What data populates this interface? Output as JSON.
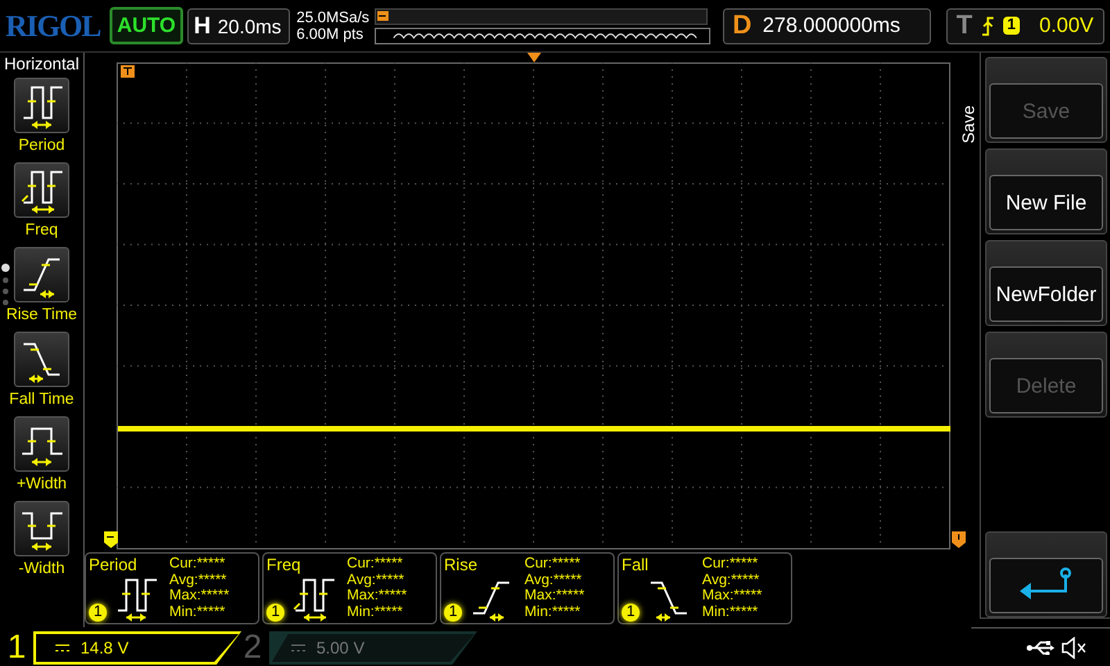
{
  "brand": "RIGOL",
  "run_state": "AUTO",
  "timebase": {
    "label": "H",
    "value": "20.0ms"
  },
  "sample_rate": "25.0MSa/s",
  "memory_depth": "6.00M pts",
  "delay": {
    "label": "D",
    "value": "278.000000ms"
  },
  "trigger": {
    "label": "T",
    "source": "1",
    "level": "0.00V"
  },
  "sidebar": {
    "title": "Horizontal",
    "page_dots": [
      {
        "selected": true
      },
      {
        "selected": false
      },
      {
        "selected": false
      },
      {
        "selected": false
      }
    ],
    "items": [
      {
        "label": "Period",
        "kind": "period"
      },
      {
        "label": "Freq",
        "kind": "freq"
      },
      {
        "label": "Rise Time",
        "kind": "rise"
      },
      {
        "label": "Fall Time",
        "kind": "fall"
      },
      {
        "label": "+Width",
        "kind": "pwidth"
      },
      {
        "label": "-Width",
        "kind": "nwidth"
      }
    ]
  },
  "measurements": [
    {
      "name": "Period",
      "kind": "period",
      "source": "1",
      "rows": [
        "Cur:*****",
        "Avg:*****",
        "Max:*****",
        "Min:*****"
      ]
    },
    {
      "name": "Freq",
      "kind": "freq",
      "source": "1",
      "rows": [
        "Cur:*****",
        "Avg:*****",
        "Max:*****",
        "Min:*****"
      ]
    },
    {
      "name": "Rise",
      "kind": "rise",
      "source": "1",
      "rows": [
        "Cur:*****",
        "Avg:*****",
        "Max:*****",
        "Min:*****"
      ]
    },
    {
      "name": "Fall",
      "kind": "fall",
      "source": "1",
      "rows": [
        "Cur:*****",
        "Avg:*****",
        "Max:*****",
        "Min:*****"
      ]
    }
  ],
  "menu": {
    "title": "Save",
    "buttons": [
      {
        "kind": "text",
        "label": "Save",
        "disabled": true
      },
      {
        "kind": "text",
        "label": "New File",
        "disabled": false
      },
      {
        "kind": "text",
        "label": "NewFolder",
        "disabled": false
      },
      {
        "kind": "text",
        "label": "Delete",
        "disabled": true
      },
      {
        "kind": "spacer"
      },
      {
        "kind": "back",
        "disabled": false
      }
    ]
  },
  "channels": [
    {
      "number": "1",
      "scale": "14.8 V",
      "active": true
    },
    {
      "number": "2",
      "scale": "5.00 V",
      "active": false
    }
  ]
}
